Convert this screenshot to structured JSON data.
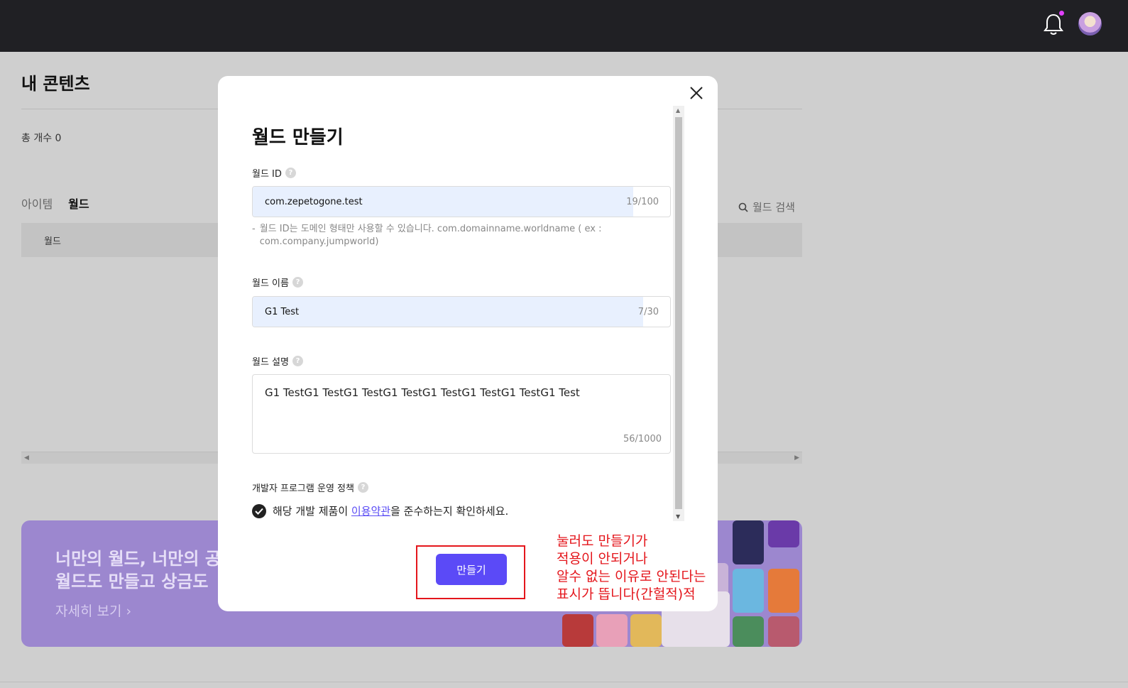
{
  "topbar": {
    "bell_icon": "bell-icon",
    "avatar_icon": "avatar"
  },
  "page": {
    "title": "내 콘텐츠",
    "total": "총 개수 0",
    "tabs": [
      {
        "label": "아이템"
      },
      {
        "label": "월드"
      }
    ],
    "search_label": "월드 검색",
    "table_header": "월드"
  },
  "banner": {
    "title_line1": "너만의 월드, 너만의 공",
    "title_line2": "월드도 만들고 상금도",
    "link": "자세히 보기 ›"
  },
  "modal": {
    "title": "월드 만들기",
    "world_id": {
      "label": "월드 ID",
      "value": "com.zepetogone.test",
      "count": "19/100",
      "hint_bullet": "-",
      "hint": "월드 ID는 도메인 형태만 사용할 수 있습니다. com.domainname.worldname ( ex : com.company.jumpworld)"
    },
    "world_name": {
      "label": "월드 이름",
      "value": "G1 Test",
      "count": "7/30"
    },
    "world_desc": {
      "label": "월드 설명",
      "value": "G1 TestG1 TestG1 TestG1 TestG1 TestG1 TestG1 TestG1 Test",
      "count": "56/1000"
    },
    "policy_label": "개발자 프로그램 운영 정책",
    "agree": {
      "before": "해당 개발 제품이 ",
      "link": "이용약관",
      "after": "을 준수하는지 확인하세요."
    },
    "create_button": "만들기"
  },
  "annotation": {
    "text": "눌러도 만들기가\n적용이 안되거나\n알수 없는 이유로 안된다는\n표시가 뜹니다(간헐적)적",
    "color": "#e4161c"
  },
  "colors": {
    "accent": "#5b4af7",
    "topbar": "#202024",
    "banner": "#9c87cf"
  }
}
